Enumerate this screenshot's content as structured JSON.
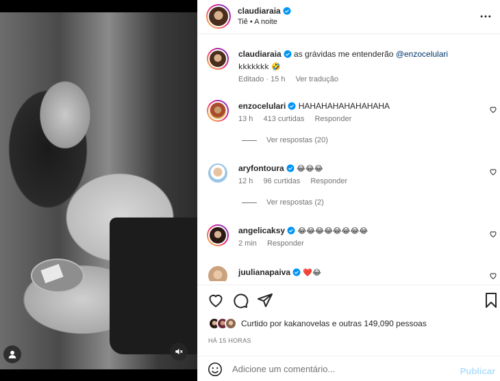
{
  "post": {
    "author": "claudiaraia",
    "location_music": "Tiê • A noite",
    "caption_user": "claudiaraia",
    "caption_text": "as grávidas me entenderão",
    "caption_mention": "@enzocelulari",
    "caption_text2": "kkkkkkk 🤣",
    "caption_time": "Editado · 15 h",
    "caption_translate": "Ver tradução"
  },
  "comments": [
    {
      "user": "enzocelulari",
      "text": "HAHAHAHAHAHAHAHA",
      "time": "13 h",
      "likes": "413 curtidas",
      "reply": "Responder",
      "view_replies": "Ver respostas (20)"
    },
    {
      "user": "aryfontoura",
      "text": "😂😂😂",
      "time": "12 h",
      "likes": "96 curtidas",
      "reply": "Responder",
      "view_replies": "Ver respostas (2)"
    },
    {
      "user": "angelicaksy",
      "text": "😂😂😂😂😂😂😂😂",
      "time": "2 min",
      "reply": "Responder"
    },
    {
      "user": "juulianapaiva",
      "text": "❤️😂"
    }
  ],
  "likes_summary": "Curtido por kakanovelas e outras 149,090 pessoas",
  "time_ago": "HÁ 15 HORAS",
  "composer": {
    "placeholder": "Adicione um comentário...",
    "post_label": "Publicar"
  },
  "colors": {
    "verified": "#0095f6",
    "link": "#00376b",
    "muted": "#737373",
    "post_button": "#b2dffc"
  },
  "icons": [
    "user-tag-icon",
    "mute-icon",
    "more-icon",
    "verified-icon",
    "heart-icon",
    "comment-icon",
    "share-icon",
    "bookmark-icon",
    "emoji-icon"
  ]
}
